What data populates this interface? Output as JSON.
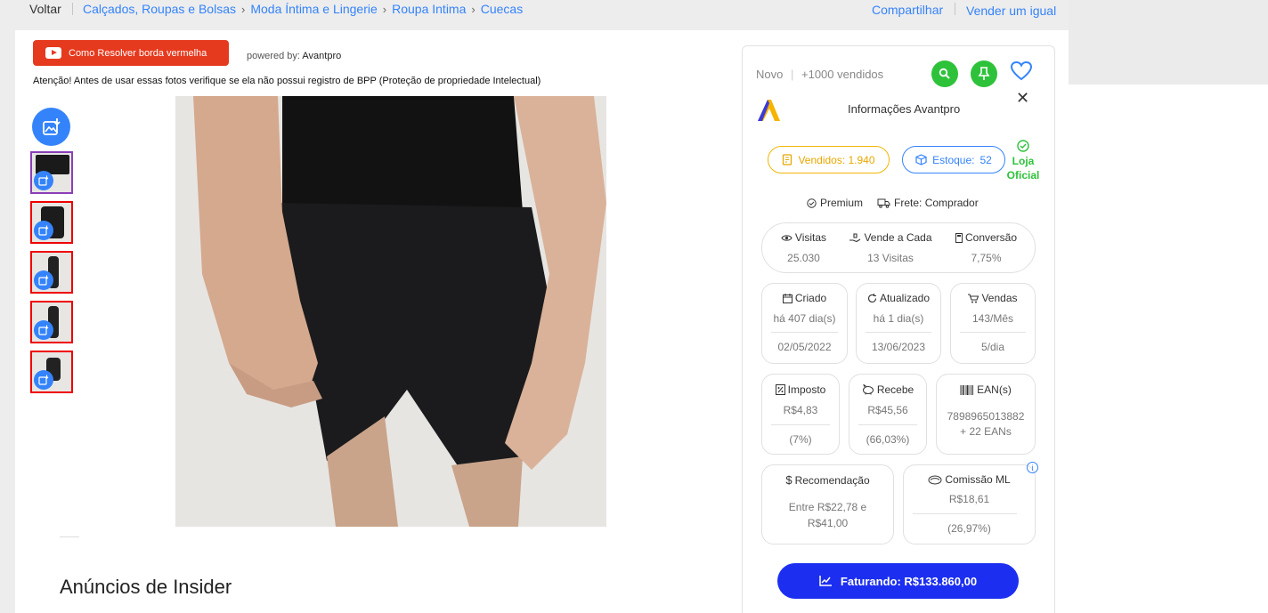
{
  "nav": {
    "back": "Voltar",
    "breadcrumbs": [
      "Calçados, Roupas e Bolsas",
      "Moda Íntima e Lingerie",
      "Roupa Intima",
      "Cuecas"
    ],
    "share": "Compartilhar",
    "sell_same": "Vender um igual"
  },
  "tool": {
    "video_button": "Como Resolver borda vermelha",
    "powered_by_label": "powered by:",
    "powered_by_name": "Avantpro",
    "warning": "Atenção! Antes de usar essas fotos verifique se ela não possui registro de BPP (Proteção de propriedade Intelectual)"
  },
  "gallery": {
    "thumbnail_count": 5,
    "active_index": 0
  },
  "section": {
    "insider_title": "Anúncios de Insider"
  },
  "panel": {
    "condition": "Novo",
    "sold_count": "+1000 vendidos",
    "info_title": "Informações Avantpro",
    "sold_label": "Vendidos: 1.940",
    "stock_label": "Estoque:",
    "stock_value": "52",
    "official_line1": "Loja",
    "official_line2": "Oficial",
    "premium": "Premium",
    "shipping": "Frete: Comprador",
    "visits_label": "Visitas",
    "visits_value": "25.030",
    "sells_every_label": "Vende a Cada",
    "sells_every_value": "13 Visitas",
    "conversion_label": "Conversão",
    "conversion_value": "7,75%",
    "created_label": "Criado",
    "created_ago": "há 407 dia(s)",
    "created_date": "02/05/2022",
    "updated_label": "Atualizado",
    "updated_ago": "há 1 dia(s)",
    "updated_date": "13/06/2023",
    "sales_label": "Vendas",
    "sales_month": "143/Mês",
    "sales_day": "5/dia",
    "tax_label": "Imposto",
    "tax_value": "R$4,83",
    "tax_pct": "(7%)",
    "receive_label": "Recebe",
    "receive_value": "R$45,56",
    "receive_pct": "(66,03%)",
    "ean_label": "EAN(s)",
    "ean_value": "7898965013882",
    "ean_more": "+ 22 EANs",
    "recommend_label": "Recomendação",
    "recommend_value": "Entre R$22,78 e R$41,00",
    "commission_label": "Comissão ML",
    "commission_value": "R$18,61",
    "commission_pct": "(26,97%)",
    "revenue_button": "Faturando: R$133.860,00"
  },
  "colors": {
    "link": "#3483fa",
    "youtube_red": "#e63a1e",
    "green": "#2ec23a",
    "revenue_blue": "#1c2ff0",
    "sold_yellow": "#f2b705"
  }
}
